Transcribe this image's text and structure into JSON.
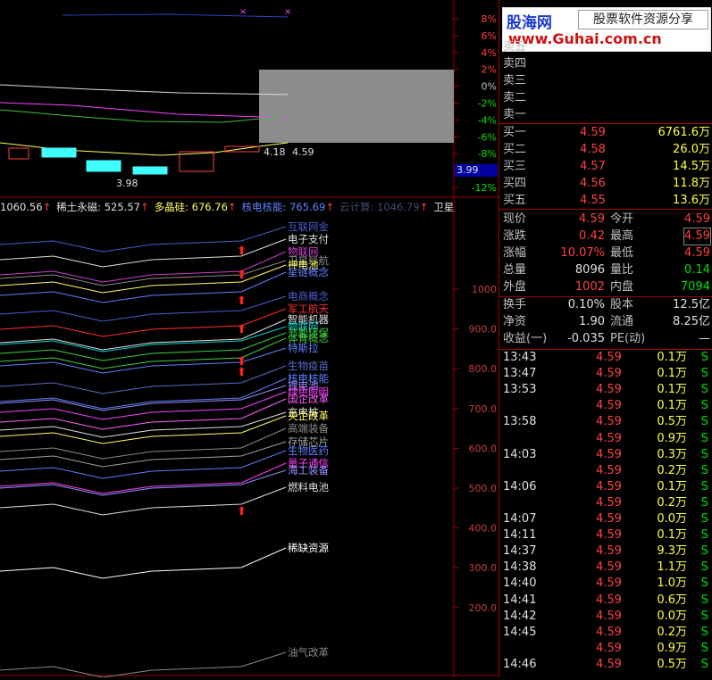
{
  "logo": {
    "brand": "股海网",
    "slogan": "股票软件资源分享",
    "url": "www.Guhai.com.cn"
  },
  "kline": {
    "pct_axis": [
      "8%",
      "6%",
      "4%",
      "2%",
      "0%",
      "-2%",
      "-4%",
      "-6%",
      "-8%",
      "-10%",
      "-12%"
    ],
    "price_tag": "3.99",
    "high_label": "4.18",
    "last_label": "4.59",
    "low_label": "3.98"
  },
  "ticker": {
    "items": [
      {
        "name": "",
        "value": "1060.56",
        "arrow": "↑",
        "color": "#e0e0e0"
      },
      {
        "name": "稀土永磁:",
        "value": "525.57",
        "arrow": "↑",
        "color": "#e0e0e0"
      },
      {
        "name": "多晶硅:",
        "value": "676.76",
        "arrow": "↑",
        "color": "#ffff60"
      },
      {
        "name": "核电核能:",
        "value": "765.69",
        "arrow": "↑",
        "color": "#6080ff"
      },
      {
        "name": "云计算:",
        "value": "1046.79",
        "arrow": "↑",
        "color": "#404a70"
      },
      {
        "name": "卫星导",
        "value": "",
        "arrow": "",
        "color": "#e0e0e0"
      }
    ]
  },
  "sector_axis": [
    "1000",
    "900.0",
    "800.0",
    "700.0",
    "600.0",
    "500.0",
    "400.0",
    "300.0",
    "200.0"
  ],
  "sectors": [
    {
      "name": "互联网金",
      "color": "#4a5ccc"
    },
    {
      "name": "电子支付",
      "color": "#e0e0e0"
    },
    {
      "name": "物联网",
      "color": "#cc40cc"
    },
    {
      "name": "卫星导航",
      "color": "#8a8a8a"
    },
    {
      "name": "押电池",
      "color": "#ffff60"
    },
    {
      "name": "星链概念",
      "color": "#6080ff"
    },
    {
      "name": "电商概念",
      "color": "#4a5ccc"
    },
    {
      "name": "军工航天",
      "color": "#ff3030"
    },
    {
      "name": "智能机器",
      "color": "#e0e0e0"
    },
    {
      "name": "物联网",
      "color": "#00d0d0"
    },
    {
      "name": "节能环保",
      "color": "#40d040"
    },
    {
      "name": "体育概念",
      "color": "#40d040"
    },
    {
      "name": "特斯拉",
      "color": "#6080ff"
    },
    {
      "name": "生物疫苗",
      "color": "#5a6ac8"
    },
    {
      "name": "核电核能",
      "color": "#6080ff"
    },
    {
      "name": "锂电池",
      "color": "#9090ff"
    },
    {
      "name": "绿色照明",
      "color": "#ff40ff"
    },
    {
      "name": "国企改革",
      "color": "#ff60ff"
    },
    {
      "name": "充电桩",
      "color": "#e0e0e0"
    },
    {
      "name": "央企改革",
      "color": "#ffff60"
    },
    {
      "name": "高端装备",
      "color": "#8a8a8a"
    },
    {
      "name": "存储芯片",
      "color": "#a0a0a0"
    },
    {
      "name": "生物医药",
      "color": "#6080ff"
    },
    {
      "name": "量子通信",
      "color": "#ff40ff"
    },
    {
      "name": "海工装备",
      "color": "#9090ff"
    },
    {
      "name": "燃料电池",
      "color": "#e0e0e0"
    },
    {
      "name": "稀缺资源",
      "color": "#ffffff"
    },
    {
      "name": "油气改革",
      "color": "#8a8a8a"
    }
  ],
  "quotes": {
    "sell": [
      {
        "label": "卖五",
        "price": "",
        "vol": ""
      },
      {
        "label": "卖四",
        "price": "",
        "vol": ""
      },
      {
        "label": "卖三",
        "price": "",
        "vol": ""
      },
      {
        "label": "卖二",
        "price": "",
        "vol": ""
      },
      {
        "label": "卖一",
        "price": "",
        "vol": ""
      }
    ],
    "buy": [
      {
        "label": "买一",
        "price": "4.59",
        "vol": "6761.6万"
      },
      {
        "label": "买二",
        "price": "4.58",
        "vol": "26.0万"
      },
      {
        "label": "买三",
        "price": "4.57",
        "vol": "14.5万"
      },
      {
        "label": "买四",
        "price": "4.56",
        "vol": "11.8万"
      },
      {
        "label": "买五",
        "price": "4.55",
        "vol": "13.6万"
      }
    ]
  },
  "stats": [
    {
      "l1": "现价",
      "v1": "4.59",
      "c1": "red",
      "l2": "今开",
      "v2": "4.59",
      "c2": "red"
    },
    {
      "l1": "涨跌",
      "v1": "0.42",
      "c1": "red",
      "l2": "最高",
      "v2": "4.59",
      "c2": "red"
    },
    {
      "l1": "涨幅",
      "v1": "10.07%",
      "c1": "red",
      "l2": "最低",
      "v2": "4.59",
      "c2": "red"
    },
    {
      "l1": "总量",
      "v1": "8096",
      "c1": "white",
      "l2": "量比",
      "v2": "0.14",
      "c2": "green"
    },
    {
      "l1": "外盘",
      "v1": "1002",
      "c1": "red",
      "l2": "内盘",
      "v2": "7094",
      "c2": "green"
    }
  ],
  "stats2": [
    {
      "l1": "换手",
      "v1": "0.10%",
      "l2": "股本",
      "v2": "12.5亿"
    },
    {
      "l1": "净资",
      "v1": "1.90",
      "l2": "流通",
      "v2": "8.25亿"
    },
    {
      "l1": "收益(一)",
      "v1": "-0.035",
      "l2": "PE(动)",
      "v2": "—"
    }
  ],
  "ticks": [
    {
      "time": "13:43",
      "price": "4.59",
      "vol": "0.1万",
      "flag": "S"
    },
    {
      "time": "13:47",
      "price": "4.59",
      "vol": "0.1万",
      "flag": "S"
    },
    {
      "time": "13:53",
      "price": "4.59",
      "vol": "0.1万",
      "flag": "S"
    },
    {
      "time": "",
      "price": "4.59",
      "vol": "0.1万",
      "flag": "S"
    },
    {
      "time": "13:58",
      "price": "4.59",
      "vol": "0.5万",
      "flag": "S"
    },
    {
      "time": "",
      "price": "4.59",
      "vol": "0.9万",
      "flag": "S"
    },
    {
      "time": "14:03",
      "price": "4.59",
      "vol": "0.3万",
      "flag": "S"
    },
    {
      "time": "",
      "price": "4.59",
      "vol": "0.2万",
      "flag": "S"
    },
    {
      "time": "14:06",
      "price": "4.59",
      "vol": "0.1万",
      "flag": "S"
    },
    {
      "time": "",
      "price": "4.59",
      "vol": "0.2万",
      "flag": "S"
    },
    {
      "time": "14:07",
      "price": "4.59",
      "vol": "0.0万",
      "flag": "S"
    },
    {
      "time": "14:11",
      "price": "4.59",
      "vol": "0.1万",
      "flag": "S"
    },
    {
      "time": "14:37",
      "price": "4.59",
      "vol": "9.3万",
      "flag": "S"
    },
    {
      "time": "14:38",
      "price": "4.59",
      "vol": "1.1万",
      "flag": "S"
    },
    {
      "time": "14:40",
      "price": "4.59",
      "vol": "1.0万",
      "flag": "S"
    },
    {
      "time": "14:41",
      "price": "4.59",
      "vol": "0.6万",
      "flag": "S"
    },
    {
      "time": "14:42",
      "price": "4.59",
      "vol": "0.0万",
      "flag": "S"
    },
    {
      "time": "14:45",
      "price": "4.59",
      "vol": "0.2万",
      "flag": "S"
    },
    {
      "time": "",
      "price": "4.59",
      "vol": "0.9万",
      "flag": "S"
    },
    {
      "time": "14:46",
      "price": "4.59",
      "vol": "0.5万",
      "flag": "S"
    }
  ],
  "colors": {
    "up": "#ff4040",
    "down": "#00e000",
    "grid": "#a00000",
    "cyan": "#40ffff"
  }
}
